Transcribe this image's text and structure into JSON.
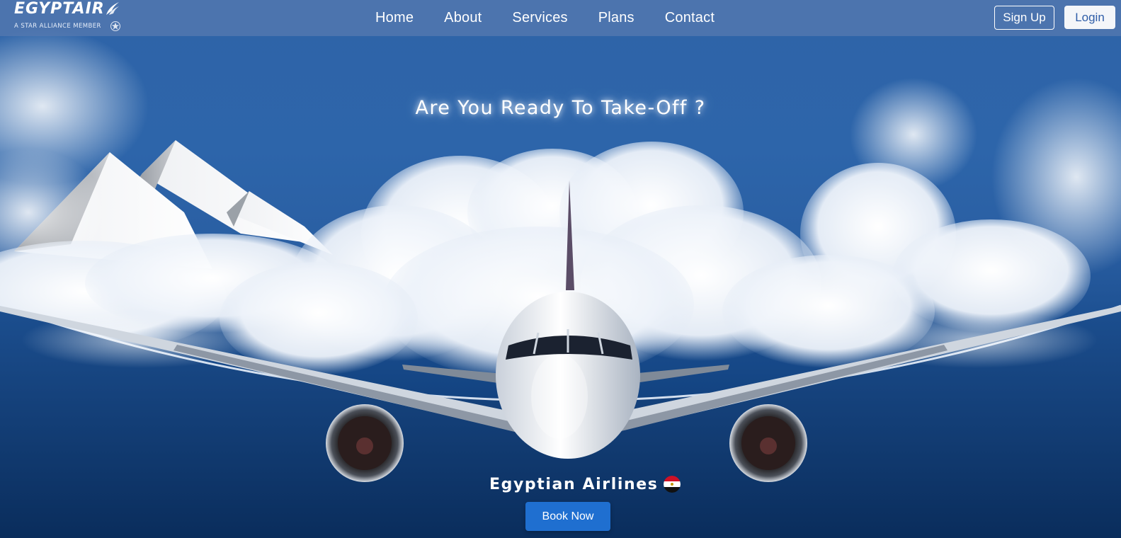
{
  "brand": {
    "logo_text": "EGYPTAIR",
    "logo_subtitle": "A STAR ALLIANCE MEMBER"
  },
  "nav": {
    "links": [
      "Home",
      "About",
      "Services",
      "Plans",
      "Contact"
    ],
    "signup_label": "Sign Up",
    "login_label": "Login"
  },
  "hero": {
    "headline": "Are You Ready To Take-Off ?",
    "airline_name": "Egyptian Airlines",
    "book_label": "Book Now"
  },
  "icons": {
    "logo": "horus-wing-icon",
    "star_alliance": "star-alliance-icon",
    "flag": "egypt-flag-icon"
  },
  "colors": {
    "sky": "#2d65aa",
    "navbar": "#5478b0",
    "book_button": "#1f6fd0",
    "login_text": "#2f5ea8"
  }
}
